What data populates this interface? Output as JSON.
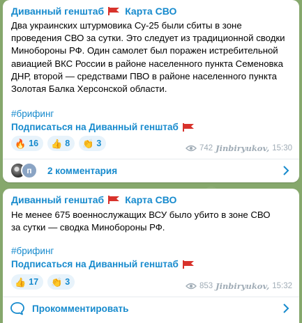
{
  "posts": [
    {
      "channel": "Диванный генштаб",
      "map": "Карта СВО",
      "lines": [
        "Два украинских штурмовика Су-25 были сбиты в зоне",
        "проведения СВО за сутки. Это следует из традиционной сводки",
        "Минобороны РФ. Один самолет был поражен истребительной",
        "авиацией ВКС России в районе населенного пункта Семеновка",
        "ДНР, второй — средствами ПВО в районе населенного пункта",
        "Золотая Балка Херсонской области."
      ],
      "hashtag": "#брифинг",
      "subscribe": "Подписаться на Диванный генштаб",
      "reactions": [
        {
          "emoji": "🔥",
          "count": "16"
        },
        {
          "emoji": "👍",
          "count": "8"
        },
        {
          "emoji": "👏",
          "count": "3"
        }
      ],
      "views": "742",
      "author": "Jinbiryukov,",
      "time": "15:30",
      "comments_label": "2 комментария",
      "avatar_letter": "п"
    },
    {
      "channel": "Диванный генштаб",
      "map": "Карта СВО",
      "lines": [
        "Не менее 675 военнослужащих ВСУ было убито в зоне СВО",
        "за сутки — сводка Минобороны РФ."
      ],
      "hashtag": "#брифинг",
      "subscribe": "Подписаться на Диванный генштаб",
      "reactions": [
        {
          "emoji": "👍",
          "count": "17"
        },
        {
          "emoji": "👏",
          "count": "3"
        }
      ],
      "views": "853",
      "author": "Jinbiryukov,",
      "time": "15:32",
      "comment_action": "Прокомментировать"
    }
  ],
  "colors": {
    "accent": "#168acd",
    "flag": "#d8322b",
    "reaction_bg": "#e8f3fb",
    "meta": "#a0acb6"
  }
}
